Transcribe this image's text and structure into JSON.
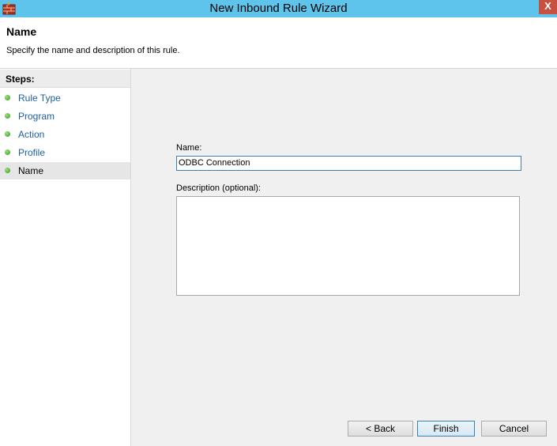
{
  "window": {
    "title": "New Inbound Rule Wizard",
    "close_glyph": "X"
  },
  "header": {
    "title": "Name",
    "subtitle": "Specify the name and description of this rule."
  },
  "steps": {
    "heading": "Steps:",
    "items": [
      {
        "label": "Rule Type"
      },
      {
        "label": "Program"
      },
      {
        "label": "Action"
      },
      {
        "label": "Profile"
      },
      {
        "label": "Name"
      }
    ],
    "active_index": 4
  },
  "form": {
    "name_label": "Name:",
    "name_value": "ODBC Connection",
    "description_label": "Description (optional):",
    "description_value": ""
  },
  "buttons": {
    "back": "< Back",
    "finish": "Finish",
    "cancel": "Cancel"
  },
  "colors": {
    "titlebar": "#5ec4ec",
    "close": "#c7503f",
    "link": "#1f5fa0",
    "step_dot": "#2f9a1a"
  }
}
